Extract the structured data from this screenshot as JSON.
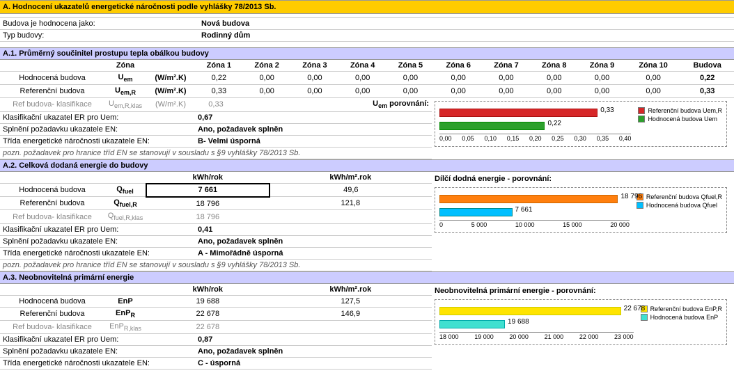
{
  "main_header": "A. Hodnocení ukazatelů energetické náročnosti podle vyhlášky 78/2013 Sb.",
  "info": {
    "l1": "Budova je hodnocena jako:",
    "v1": "Nová budova",
    "l2": "Typ budovy:",
    "v2": "Rodinný dům"
  },
  "a1": {
    "header": "A.1. Průměrný součinitel prostupu tepla obálkou budovy",
    "col_zona": "Zóna",
    "zones": [
      "Zóna 1",
      "Zóna 2",
      "Zóna 3",
      "Zóna 4",
      "Zóna 5",
      "Zóna 6",
      "Zóna 7",
      "Zóna 8",
      "Zóna 9",
      "Zóna 10"
    ],
    "col_budova": "Budova",
    "unit": "(W/m².K)",
    "r1_label": "Hodnocená budova",
    "r1_q": "Uₑₘ",
    "r1_vals": [
      "0,22",
      "0,00",
      "0,00",
      "0,00",
      "0,00",
      "0,00",
      "0,00",
      "0,00",
      "0,00",
      "0,00"
    ],
    "r1_b": "0,22",
    "r2_label": "Referenční budova",
    "r2_q": "Uₑₘ,R",
    "r2_vals": [
      "0,33",
      "0,00",
      "0,00",
      "0,00",
      "0,00",
      "0,00",
      "0,00",
      "0,00",
      "0,00",
      "0,00"
    ],
    "r2_b": "0,33",
    "r3_label": "Ref budova- klasifikace",
    "r3_q": "Uₑₘ,R,klas",
    "r3_v1": "0,33",
    "compare_label": "Uₑₘ porovnání:",
    "k1_l": "Klasifikační ukazatel ER pro Uem:",
    "k1_v": "0,67",
    "k2_l": "Splnění požadavku ukazatele EN:",
    "k2_v": "Ano, požadavek splněn",
    "k3_l": "Třída energetické náročnosti ukazatele EN:",
    "k3_v": "B- Velmi úsporná",
    "note": "pozn. požadavek pro hranice tříd EN se stanovují v sousladu s §9 vyhlášky 78/2013 Sb.",
    "chart_legend1": "Referenční budova Uem,R",
    "chart_legend2": "Hodnocená budova Uem"
  },
  "a2": {
    "header": "A.2. Celková dodaná energie do budovy",
    "col1": "kWh/rok",
    "col2": "kWh/m².rok",
    "chart_title": "Dílčí dodná energie - porovnání:",
    "r1_label": "Hodnocená budova",
    "r1_q": "Qfuel",
    "r1_v1": "7 661",
    "r1_v2": "49,6",
    "r2_label": "Referenční budova",
    "r2_q": "Qfuel,R",
    "r2_v1": "18 796",
    "r2_v2": "121,8",
    "r3_label": "Ref budova- klasifikace",
    "r3_q": "Qfuel,R,klas",
    "r3_v1": "18 796",
    "k1_l": "Klasifikační ukazatel ER pro Uem:",
    "k1_v": "0,41",
    "k2_l": "Splnění požadavku ukazatele EN:",
    "k2_v": "Ano, požadavek splněn",
    "k3_l": "Třída energetické náročnosti ukazatele EN:",
    "k3_v": "A - Mimořádně úsporná",
    "note": "pozn. požadavek pro hranice tříd EN se stanovují v sousladu s §9 vyhlášky 78/2013 Sb.",
    "chart_legend1": "Referenční budova Qfuel,R",
    "chart_legend2": "Hodnocená budova Qfuel"
  },
  "a3": {
    "header": "A.3. Neobnovitelná primární energie",
    "col1": "kWh/rok",
    "col2": "kWh/m².rok",
    "chart_title": "Neobnovitelná primární energie - porovnání:",
    "r1_label": "Hodnocená budova",
    "r1_q": "EnP",
    "r1_v1": "19 688",
    "r1_v2": "127,5",
    "r2_label": "Referenční budova",
    "r2_q": "EnPR",
    "r2_v1": "22 678",
    "r2_v2": "146,9",
    "r3_label": "Ref budova- klasifikace",
    "r3_q": "EnPR,klas",
    "r3_v1": "22 678",
    "k1_l": "Klasifikační ukazatel ER pro Uem:",
    "k1_v": "0,87",
    "k2_l": "Splnění požadavku ukazatele EN:",
    "k2_v": "Ano, požadavek splněn",
    "k3_l": "Třída energetické náročnosti ukazatele EN:",
    "k3_v": "C - úsporná",
    "chart_legend1": "Referenční budova EnP,R",
    "chart_legend2": "Hodnocená budova EnP"
  },
  "chart_data": [
    {
      "type": "bar",
      "orientation": "horizontal",
      "title": "Uem porovnání",
      "series": [
        {
          "name": "Referenční budova Uem,R",
          "value": 0.33,
          "color": "#d62728"
        },
        {
          "name": "Hodnocená budova Uem",
          "value": 0.22,
          "color": "#2ca02c"
        }
      ],
      "xlim": [
        0.0,
        0.4
      ],
      "ticks": [
        "0,00",
        "0,05",
        "0,10",
        "0,15",
        "0,20",
        "0,25",
        "0,30",
        "0,35",
        "0,40"
      ]
    },
    {
      "type": "bar",
      "orientation": "horizontal",
      "title": "Dílčí dodná energie - porovnání",
      "series": [
        {
          "name": "Referenční budova Qfuel,R",
          "value": 18796,
          "color": "#ff7f0e"
        },
        {
          "name": "Hodnocená budova Qfuel",
          "value": 7661,
          "color": "#00bfff"
        }
      ],
      "xlim": [
        0,
        20000
      ],
      "ticks": [
        "0",
        "5 000",
        "10 000",
        "15 000",
        "20 000"
      ]
    },
    {
      "type": "bar",
      "orientation": "horizontal",
      "title": "Neobnovitelná primární energie - porovnání",
      "series": [
        {
          "name": "Referenční budova EnP,R",
          "value": 22678,
          "color": "#ffe400"
        },
        {
          "name": "Hodnocená budova EnP",
          "value": 19688,
          "color": "#40e0d0"
        }
      ],
      "xlim": [
        18000,
        23000
      ],
      "ticks": [
        "18 000",
        "19 000",
        "20 000",
        "21 000",
        "22 000",
        "23 000"
      ]
    }
  ]
}
